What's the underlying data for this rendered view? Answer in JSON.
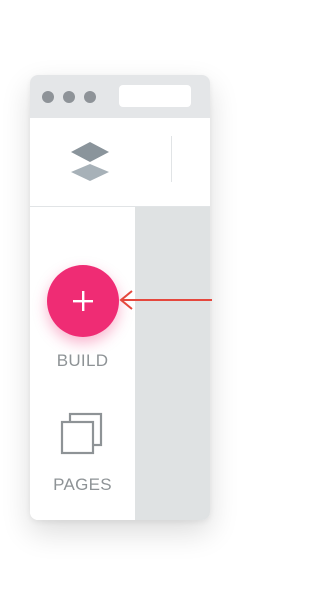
{
  "colors": {
    "accent": "#ef2c74",
    "arrow": "#e5473d",
    "label": "#8e9396",
    "canvas": "#dfe2e3",
    "titlebar": "#e4e6e8"
  },
  "window": {
    "title_dots": [
      "close",
      "minimize",
      "maximize"
    ]
  },
  "toolbar": {
    "logo_icon": "layers-icon"
  },
  "sidebar": {
    "build": {
      "label": "BUILD",
      "icon": "plus-icon"
    },
    "pages": {
      "label": "PAGES",
      "icon": "pages-icon"
    }
  },
  "annotation": {
    "icon": "arrow-left-icon"
  }
}
